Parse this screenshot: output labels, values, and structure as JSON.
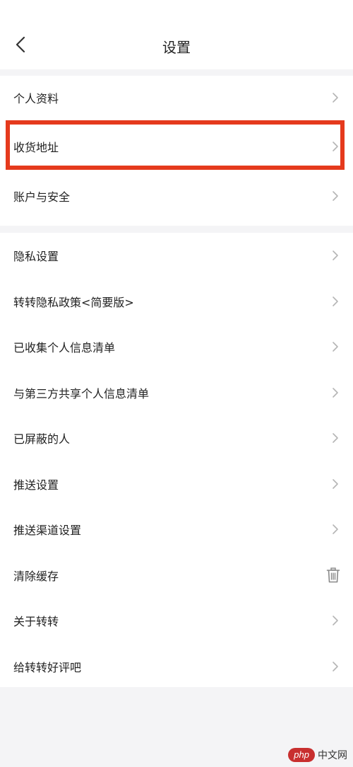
{
  "header": {
    "title": "设置",
    "back_icon": "chevron-left-icon"
  },
  "groups": [
    {
      "items": [
        {
          "label": "个人资料",
          "icon": "chevron-right-icon"
        },
        {
          "label": "收货地址",
          "icon": "chevron-right-icon",
          "highlighted": true
        },
        {
          "label": "账户与安全",
          "icon": "chevron-right-icon"
        }
      ]
    },
    {
      "items": [
        {
          "label": "隐私设置",
          "icon": "chevron-right-icon"
        },
        {
          "label": "转转隐私政策<简要版>",
          "icon": "chevron-right-icon"
        },
        {
          "label": "已收集个人信息清单",
          "icon": "chevron-right-icon"
        },
        {
          "label": "与第三方共享个人信息清单",
          "icon": "chevron-right-icon"
        },
        {
          "label": "已屏蔽的人",
          "icon": "chevron-right-icon"
        },
        {
          "label": "推送设置",
          "icon": "chevron-right-icon"
        },
        {
          "label": "推送渠道设置",
          "icon": "chevron-right-icon"
        },
        {
          "label": "清除缓存",
          "icon": "trash-icon"
        },
        {
          "label": "关于转转",
          "icon": "chevron-right-icon"
        },
        {
          "label": "给转转好评吧",
          "icon": "chevron-right-icon"
        }
      ]
    }
  ],
  "highlight_color": "#e53a1d",
  "watermark": {
    "badge": "php",
    "text": "中文网"
  }
}
